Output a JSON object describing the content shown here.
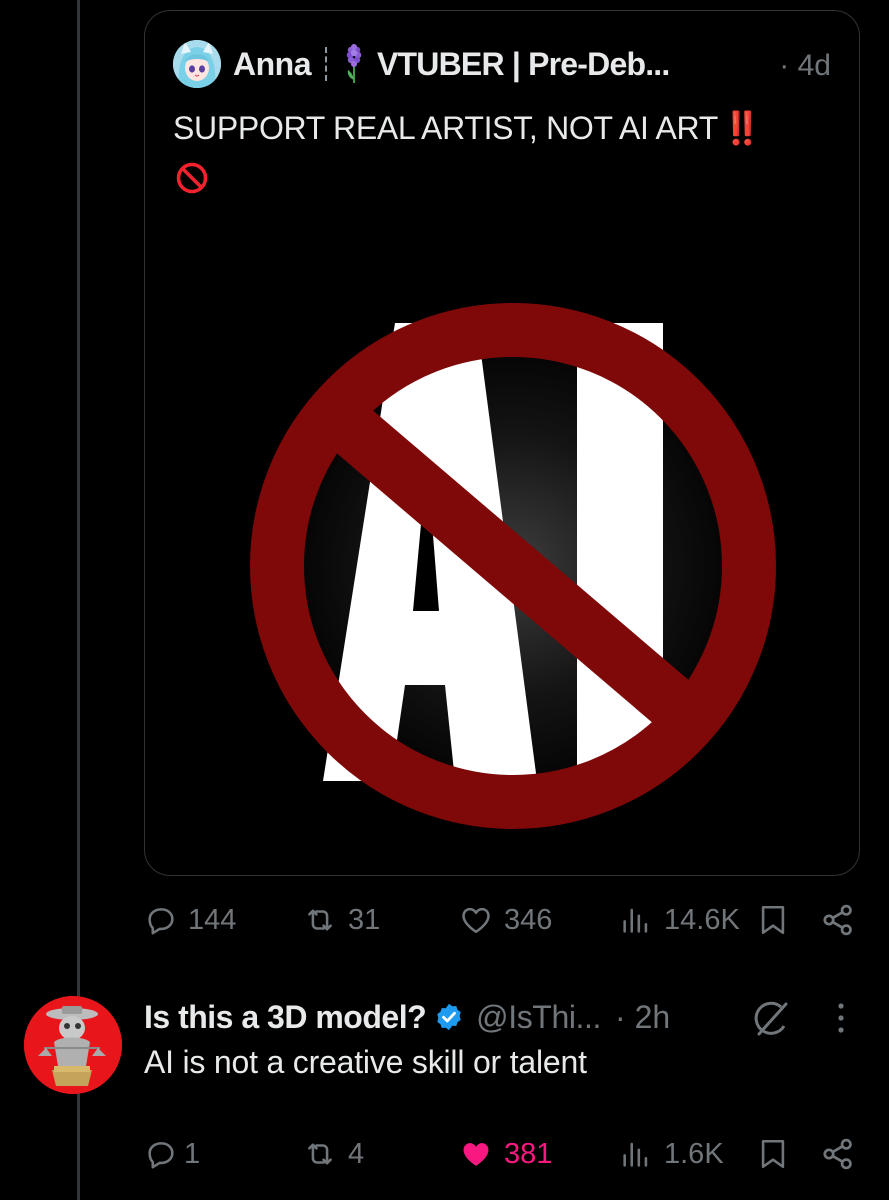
{
  "quoted_post": {
    "author_name": "Anna",
    "author_display": "VTUBER | Pre-Deb...",
    "time": "· 4d",
    "text": "SUPPORT REAL ARTIST, NOT AI ART",
    "emoji_exclaim": "‼️",
    "media_text": "AI",
    "metrics": {
      "replies": "144",
      "reposts": "31",
      "likes": "346",
      "views": "14.6K"
    }
  },
  "reply_post": {
    "author_name": "Is this a 3D model?",
    "handle": "@IsThi...",
    "time": "· 2h",
    "text": "AI is not a creative skill or talent",
    "metrics": {
      "replies": "1",
      "reposts": "4",
      "likes": "381",
      "views": "1.6K"
    }
  },
  "colors": {
    "background": "#000000",
    "text_primary": "#e7e9ea",
    "text_secondary": "#71767b",
    "like_active": "#f91880",
    "verified_blue": "#1d9bf0",
    "prohibition_red": "#7f0909"
  },
  "icons": [
    "reply-icon",
    "repost-icon",
    "like-icon",
    "views-icon",
    "bookmark-icon",
    "share-icon",
    "verified-badge-icon",
    "grok-icon",
    "more-icon",
    "prohibited-emoji-icon",
    "hyacinth-emoji-icon"
  ]
}
